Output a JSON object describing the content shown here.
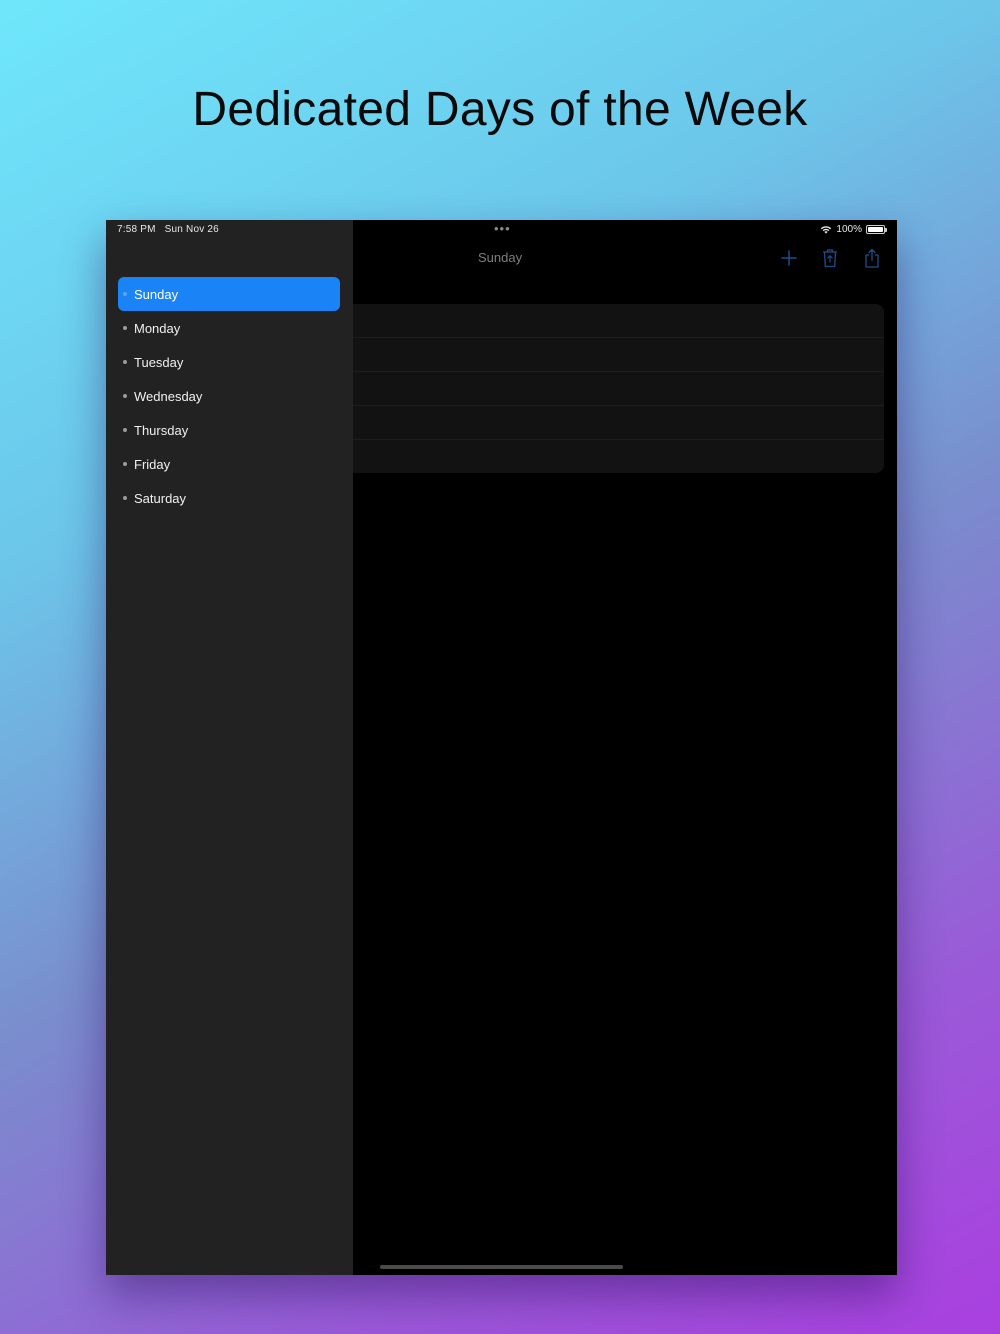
{
  "headline": "Dedicated Days of the Week",
  "status_bar": {
    "time": "7:58 PM",
    "date": "Sun Nov 26",
    "battery": "100%",
    "battery_level": 1.0
  },
  "sidebar": {
    "selected_index": 0,
    "items": [
      {
        "label": "Sunday"
      },
      {
        "label": "Monday"
      },
      {
        "label": "Tuesday"
      },
      {
        "label": "Wednesday"
      },
      {
        "label": "Thursday"
      },
      {
        "label": "Friday"
      },
      {
        "label": "Saturday"
      }
    ]
  },
  "detail": {
    "title": "Sunday",
    "actions": [
      {
        "icon": "plus-icon"
      },
      {
        "icon": "trash-icon"
      },
      {
        "icon": "share-icon"
      }
    ],
    "row_count": 5
  },
  "colors": {
    "accent": "#1a84f7",
    "sidebar_bg": "#222222",
    "content_bg": "#000000",
    "card_bg": "#121212",
    "toolbar_icon": "#1c4f8a"
  }
}
